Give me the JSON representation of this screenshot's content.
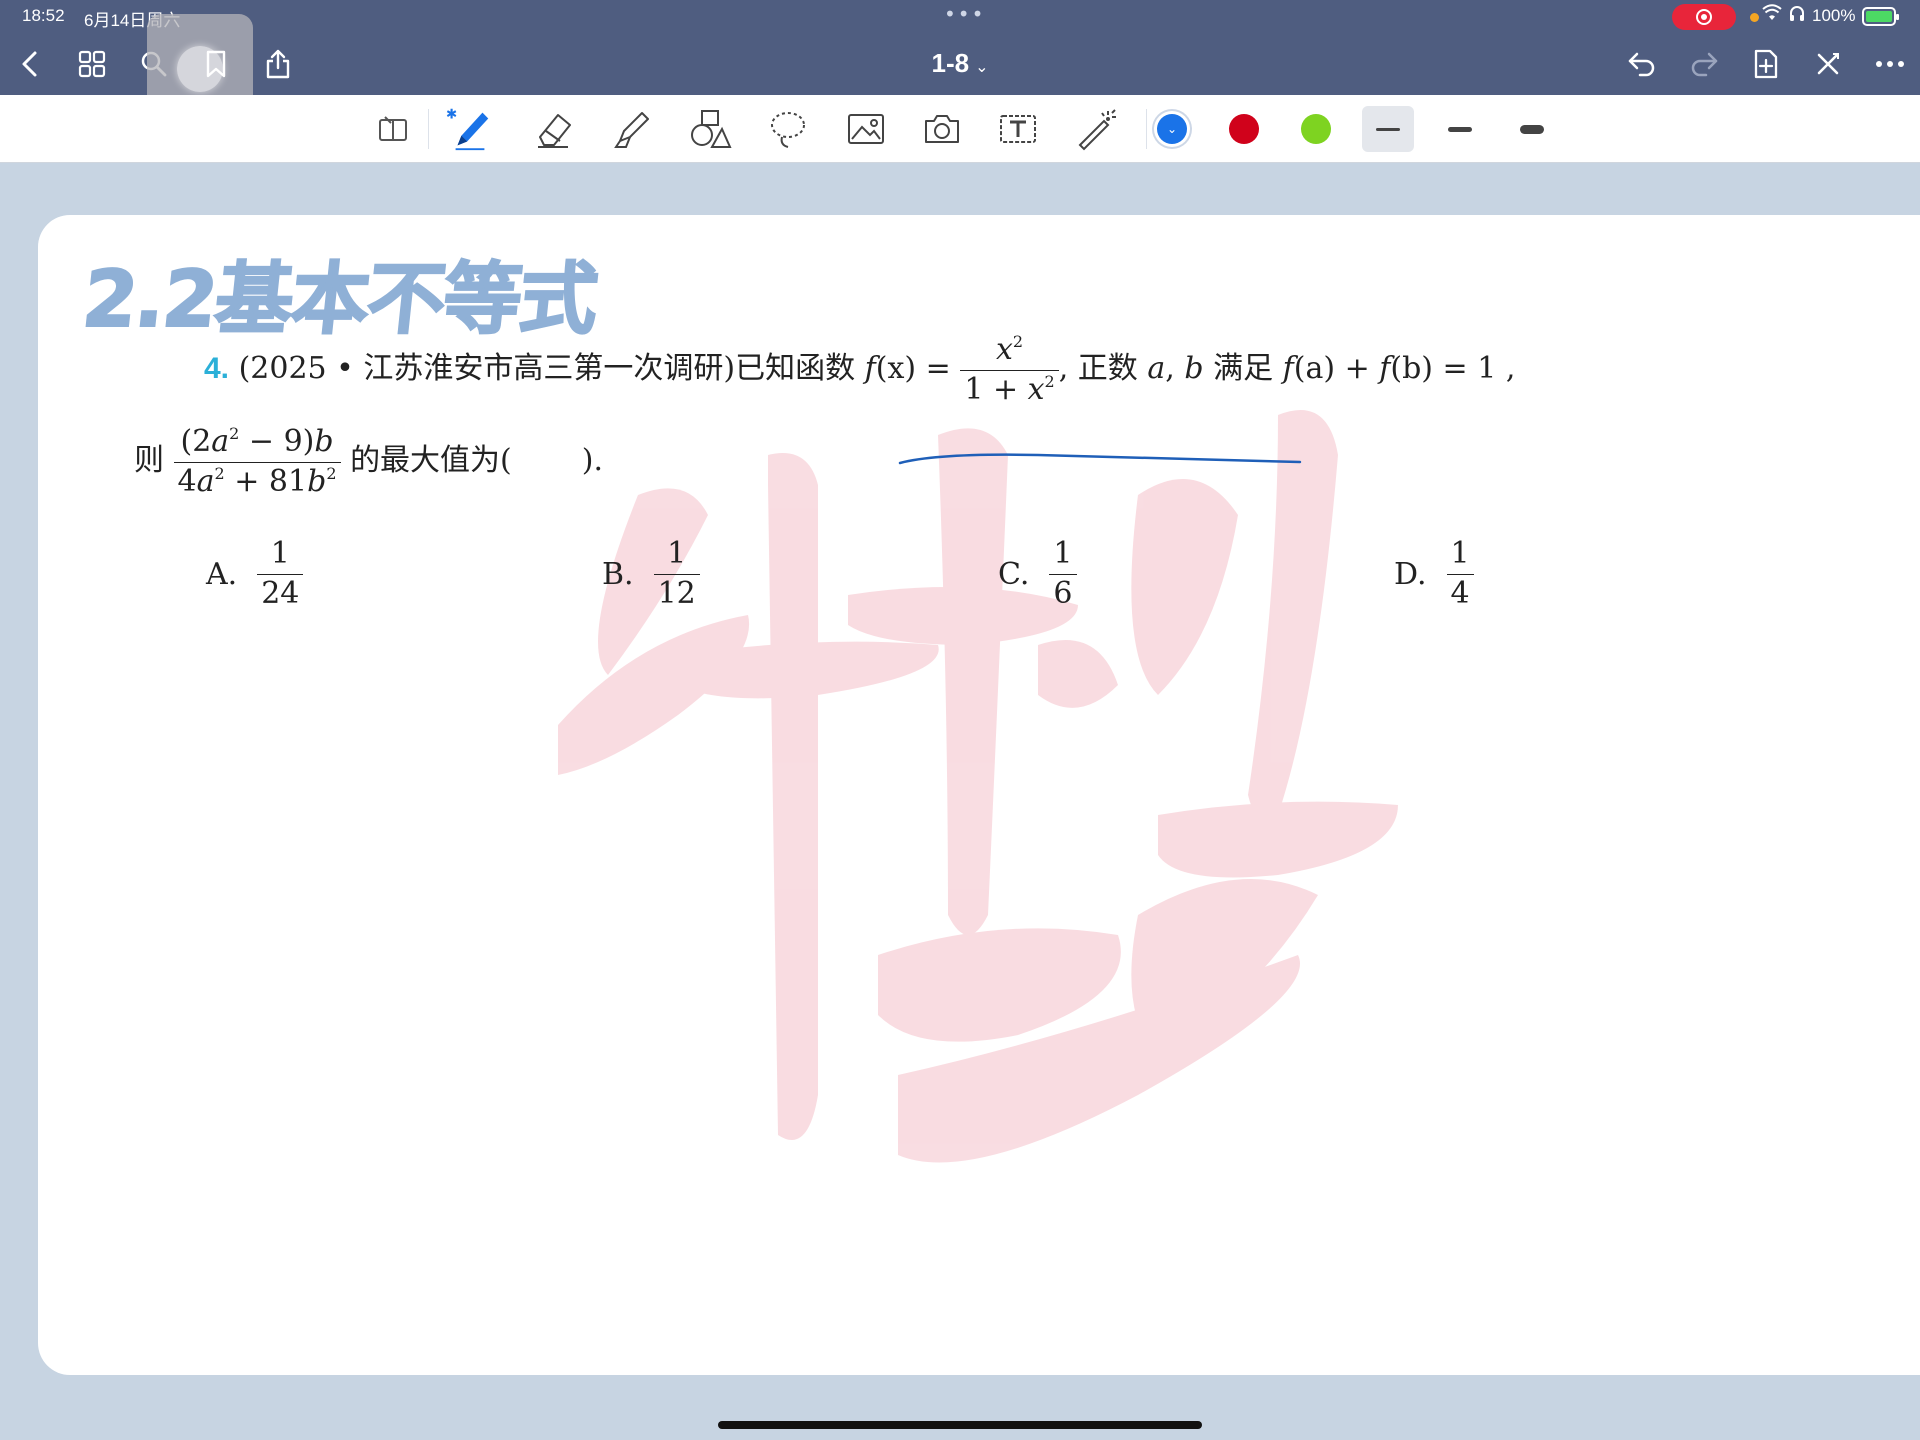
{
  "status_bar": {
    "time": "18:52",
    "date": "6月14日周六",
    "dots": "•••",
    "battery_text": "100%",
    "battery_level": 1.0
  },
  "nav": {
    "title": "1-8",
    "title_chevron": "⌄",
    "icons": [
      "back-chevron-icon",
      "grid-icon",
      "search-icon",
      "bookmark-icon",
      "share-icon",
      "undo-icon",
      "redo-icon",
      "add-page-icon",
      "close-x-icon",
      "more-icon"
    ]
  },
  "toolbar": {
    "tools": [
      "read-mode-icon",
      "pen-icon",
      "eraser-icon",
      "highlighter-icon",
      "shapes-icon",
      "lasso-icon",
      "image-icon",
      "camera-icon",
      "text-box-icon",
      "laser-pointer-icon"
    ],
    "colors": [
      "#1a73e8",
      "#d0021b",
      "#7ed321"
    ],
    "selected_color": "#1a73e8",
    "stroke_widths": [
      "thin",
      "medium",
      "thick"
    ],
    "selected_width": "thin"
  },
  "document": {
    "section_title": "2.2基本不等式",
    "question": {
      "number": "4.",
      "source": "(2025 • 江苏淮安市高三第一次调研)已知函数",
      "fx": "f",
      "fx_arg": "(x)",
      "equals": "=",
      "frac1_num": "x",
      "frac1_num_exp": "2",
      "frac1_den_pre": "1 + ",
      "frac1_den_var": "x",
      "frac1_den_exp": "2",
      "text_after": ", 正数",
      "var_a": "a",
      "comma": ", ",
      "var_b": "b",
      "satisfy": "满足",
      "cond_fa": "f",
      "cond_fa_arg": "(a)",
      "cond_plus": " + ",
      "cond_fb": "f",
      "cond_fb_arg": "(b)",
      "cond_eq": " = 1 ,",
      "then": "则",
      "frac2_num_pre": "(2",
      "frac2_num_a": "a",
      "frac2_num_exp": "2",
      "frac2_num_mid": " − 9)",
      "frac2_num_b": "b",
      "frac2_den_pre": "4",
      "frac2_den_a": "a",
      "frac2_den_exp_a": "2",
      "frac2_den_mid": " + 81",
      "frac2_den_b": "b",
      "frac2_den_exp_b": "2",
      "ask": "的最大值为(",
      "ask_end": ").",
      "options": [
        {
          "label": "A.",
          "num": "1",
          "den": "24"
        },
        {
          "label": "B.",
          "num": "1",
          "den": "12"
        },
        {
          "label": "C.",
          "num": "1",
          "den": "6"
        },
        {
          "label": "D.",
          "num": "1",
          "den": "4"
        }
      ]
    }
  }
}
